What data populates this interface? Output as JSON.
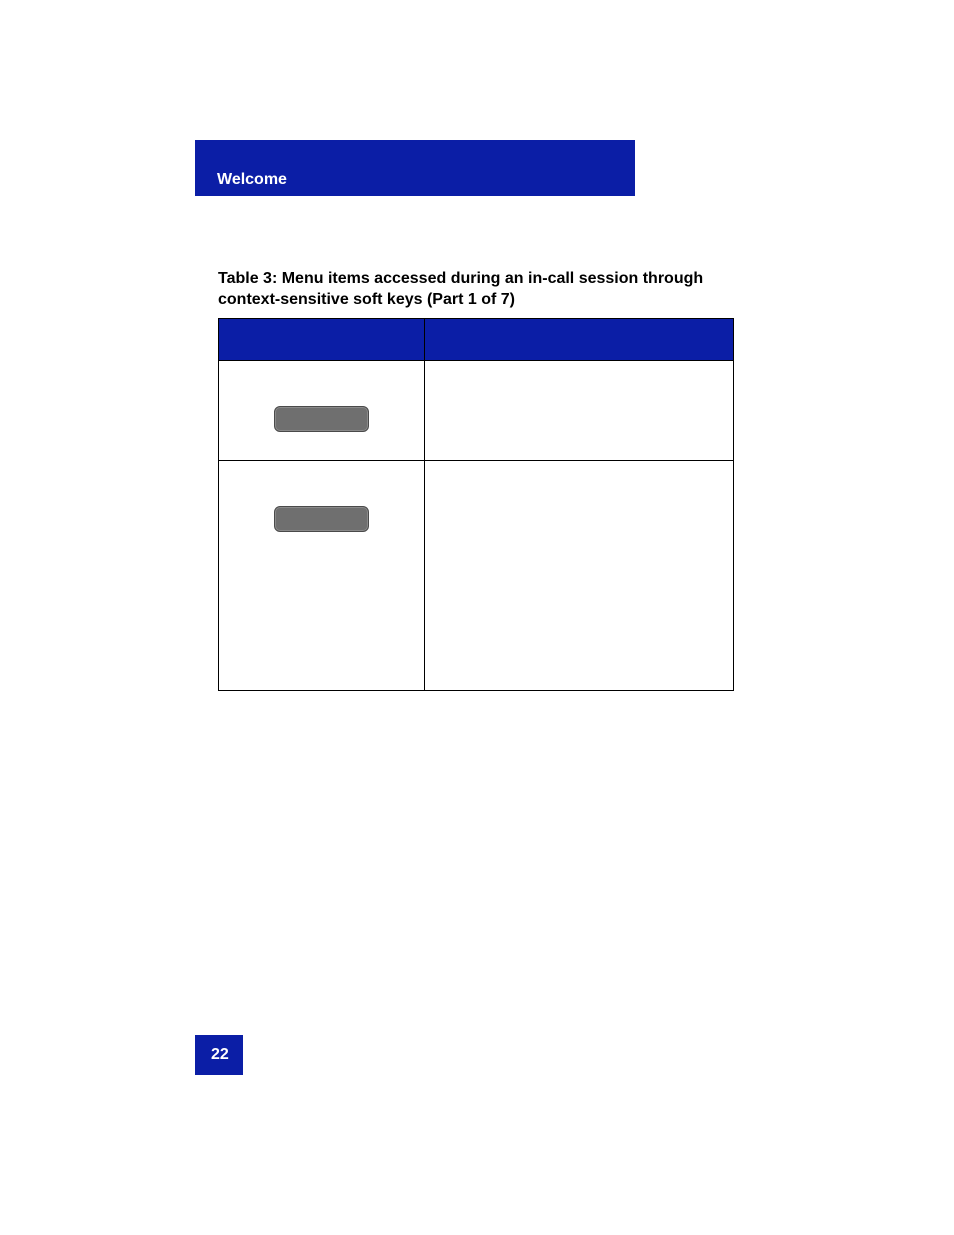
{
  "header": {
    "section": "Welcome"
  },
  "caption": "Table 3: Menu items accessed during an in-call session through context-sensitive soft keys (Part 1 of 7)",
  "table": {
    "header": {
      "left": "",
      "right": ""
    },
    "rows": [
      {
        "softkey_label": "",
        "description": ""
      },
      {
        "softkey_label": "",
        "description": ""
      }
    ]
  },
  "page_number": "22"
}
